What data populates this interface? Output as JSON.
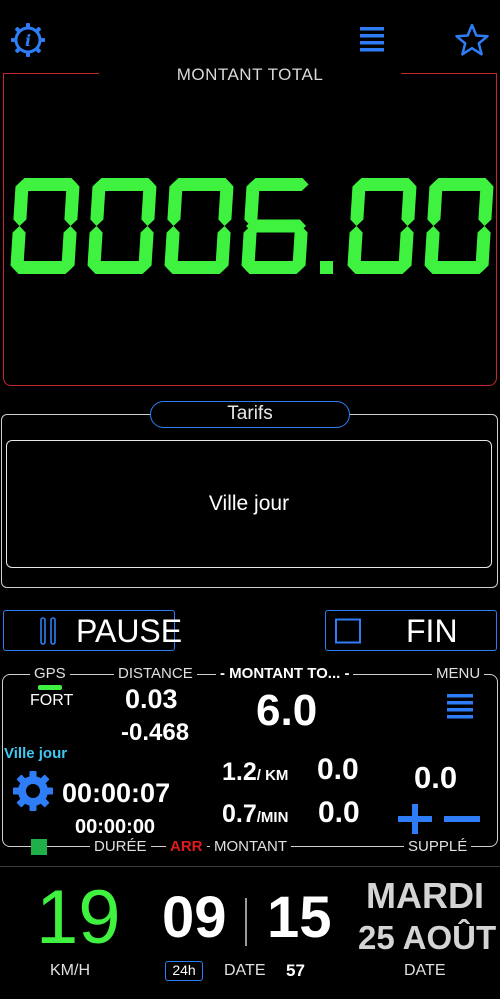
{
  "colors": {
    "accent": "#2f7df6",
    "display_green": "#3ff23f",
    "alert_red": "#c1272d",
    "rate_cyan": "#3fc8f2"
  },
  "top_bar": {
    "info_icon": "info-gear-icon",
    "menu_icon": "hamburger-icon",
    "favorite_icon": "star-icon"
  },
  "total": {
    "title": "MONTANT TOTAL",
    "value": "0006.00"
  },
  "tarifs": {
    "label": "Tarifs",
    "selected": "Ville jour"
  },
  "buttons": {
    "pause_label": "PAUSE",
    "fin_label": "FIN"
  },
  "panel": {
    "gps_label": "GPS",
    "gps_status": "FORT",
    "distance_label": "DISTANCE",
    "distance_value": "0.03",
    "distance_delta": "-0.468",
    "amount_label": "MONTANT TO...",
    "amount_value": "6.0",
    "menu_label": "MENU",
    "rate_name": "Ville jour",
    "elapsed_time": "00:00:07",
    "stopped_time": "00:00:00",
    "km_rate": "1.2",
    "km_unit": "/ KM",
    "km_amount": "0.0",
    "min_rate": "0.7",
    "min_unit": "/MIN",
    "min_amount": "0.0",
    "supplement_value": "0.0",
    "duration_label": "DURÉE",
    "arr_label": "ARR",
    "montant_label": "MONTANT",
    "supplement_label": "SUPPLÉ"
  },
  "bottom": {
    "speed": "19",
    "speed_unit": "KM/H",
    "hours": "09",
    "minutes": "15",
    "format_badge": "24h",
    "date_label": "DATE",
    "seconds": "57",
    "day": "MARDI",
    "date": "25 AOÛT",
    "date_label_right": "DATE"
  }
}
